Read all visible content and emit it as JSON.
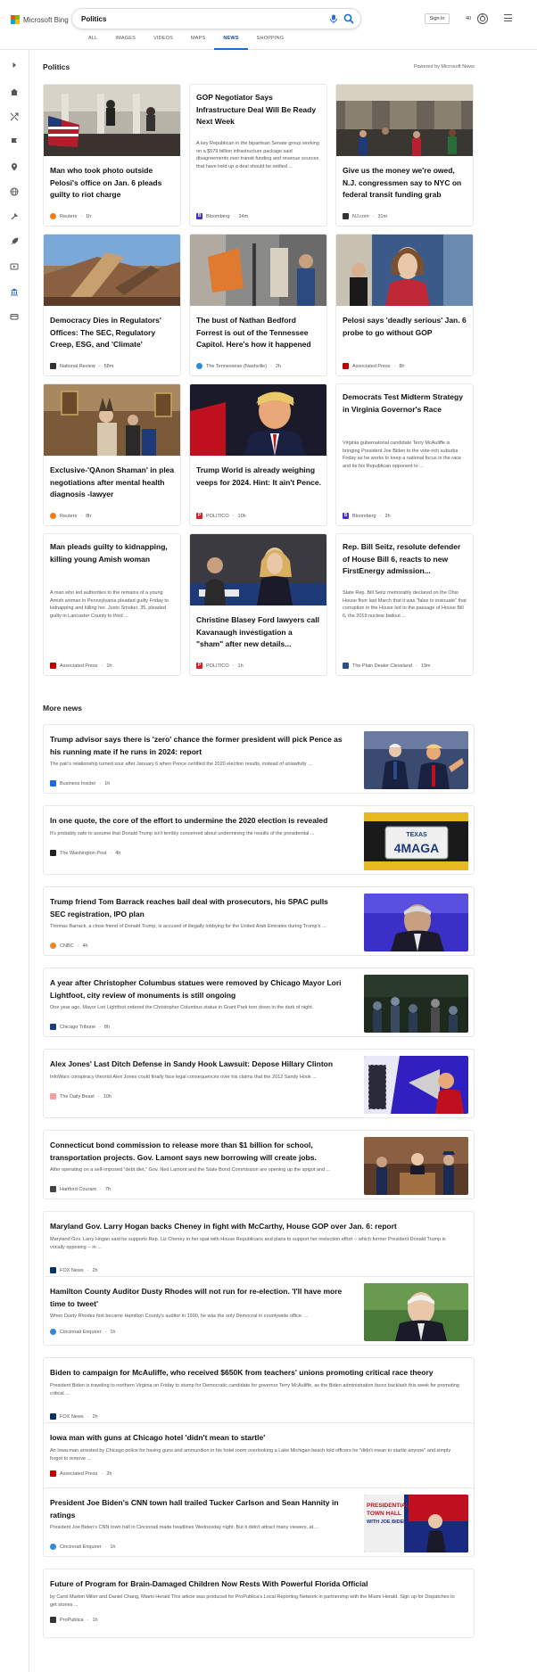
{
  "header": {
    "brand": "Microsoft Bing",
    "query": "Politics",
    "signin_label": "Sign in",
    "points": "40"
  },
  "tabs": [
    {
      "label": "ALL"
    },
    {
      "label": "IMAGES"
    },
    {
      "label": "VIDEOS"
    },
    {
      "label": "MAPS"
    },
    {
      "label": "NEWS",
      "active": true
    },
    {
      "label": "SHOPPING"
    }
  ],
  "section": {
    "title": "Politics",
    "powered": "Powered by Microsoft News"
  },
  "cards": [
    {
      "title": "Man who took photo outside Pelosi's office on Jan. 6 pleads guilty to riot charge",
      "source": "Reuters",
      "age": "1h",
      "icon": "reuters-icon",
      "color": "#f07a1a"
    },
    {
      "title": "GOP Negotiator Says Infrastructure Deal Will Be Ready Next Week",
      "snippet": "A key Republican in the bipartisan Senate group working on a $579 billion infrastructure package said disagreements over transit funding and revenue sources that have held up a deal should be settled ...",
      "source": "Bloomberg",
      "age": "34m",
      "icon": "bloomberg-icon",
      "color": "#472bd6"
    },
    {
      "title": "Give us the money we're owed, N.J. congressmen say to NYC on federal transit funding grab",
      "source": "NJ.com",
      "age": "31m",
      "icon": "njcom-icon",
      "color": "#333333"
    },
    {
      "title": "Democracy Dies in Regulators' Offices: The SEC, Regulatory Creep, ESG, and 'Climate'",
      "source": "National Review",
      "age": "58m",
      "icon": "national-review-icon",
      "color": "#333333"
    },
    {
      "title": "The bust of Nathan Bedford Forrest is out of the Tennessee Capitol. Here's how it happened",
      "source": "The Tennessean (Nashville)",
      "age": "2h",
      "icon": "tennessean-icon",
      "color": "#2f8ad8"
    },
    {
      "title": "Pelosi says 'deadly serious' Jan. 6 probe to go without GOP",
      "source": "Associated Press",
      "age": "8h",
      "icon": "ap-icon",
      "color": "#c00000"
    },
    {
      "title": "Exclusive-'QAnon Shaman' in plea negotiations after mental health diagnosis -lawyer",
      "source": "Reuters",
      "age": "8h",
      "icon": "reuters-icon",
      "color": "#f07a1a"
    },
    {
      "title": "Trump World is already weighing veeps for 2024. Hint: It ain't Pence.",
      "source": "POLITICO",
      "age": "10h",
      "icon": "politico-icon",
      "color": "#d8202a"
    },
    {
      "title": "Democrats Test Midterm Strategy in Virginia Governor's Race",
      "snippet": "Virginia gubernatorial candidate Terry McAuliffe is bringing President Joe Biden to the vote-rich suburbs Friday as he works to keep a national focus in the race and tie his Republican opponent to ...",
      "source": "Bloomberg",
      "age": "2h",
      "icon": "bloomberg-icon",
      "color": "#472bd6"
    },
    {
      "title": "Man pleads guilty to kidnapping, killing young Amish woman",
      "snippet": "A man who led authorities to the remains of a young Amish woman in Pennsylvania pleaded guilty Friday to kidnapping and killing her. Justo Smoker, 35, pleaded guilty in Lancaster County to third ...",
      "source": "Associated Press",
      "age": "1h",
      "icon": "ap-icon",
      "color": "#c00000"
    },
    {
      "title": "Christine Blasey Ford lawyers call Kavanaugh investigation a \"sham\" after new details...",
      "source": "POLITICO",
      "age": "1h",
      "icon": "politico-icon",
      "color": "#d8202a"
    },
    {
      "title": "Rep. Bill Seitz, resolute defender of House Bill 6, reacts to new FirstEnergy admission...",
      "snippet": "State Rep. Bill Seitz memorably declared on the Ohio House floor last March that it was \"false to insinuate\" that corruption in the House led to the passage of House Bill 6, the 2019 nuclear bailout ...",
      "source": "The Plain Dealer Cleveland",
      "age": "19m",
      "icon": "plain-dealer-icon",
      "color": "#2b4e8a"
    }
  ],
  "more_title": "More news",
  "more": [
    {
      "title": "Trump advisor says there is 'zero' chance the former president will pick Pence as his running mate if he runs in 2024: report",
      "snippet": "The pair's relationship turned sour after January 6 when Pence certified the 2020 election results, instead of unlawfully ...",
      "source": "Business Insider",
      "age": "1h",
      "icon": "business-insider-icon",
      "color": "#1e6be0"
    },
    {
      "title": "In one quote, the core of the effort to undermine the 2020 election is revealed",
      "snippet": "It's probably safe to assume that Donald Trump isn't terribly concerned about undermining the results of the presidential ...",
      "source": "The Washington Post",
      "age": "4h",
      "icon": "washington-post-icon",
      "color": "#222222"
    },
    {
      "title": "Trump friend Tom Barrack reaches bail deal with prosecutors, his SPAC pulls SEC registration, IPO plan",
      "snippet": "Thomas Barrack, a close friend of Donald Trump, is accused of illegally lobbying for the United Arab Emirates during Trump's ...",
      "source": "CNBC",
      "age": "4h",
      "icon": "cnbc-icon",
      "color": "#e8862a"
    },
    {
      "title": "A year after Christopher Columbus statues were removed by Chicago Mayor Lori Lightfoot, city review of monuments is still ongoing",
      "snippet": "One year ago, Mayor Lori Lightfoot ordered the Christopher Columbus statue in Grant Park torn down in the dark of night.",
      "source": "Chicago Tribune",
      "age": "8h",
      "icon": "chicago-tribune-icon",
      "color": "#1a3e78"
    },
    {
      "title": "Alex Jones' Last Ditch Defense in Sandy Hook Lawsuit: Depose Hillary Clinton",
      "snippet": "InfoWars conspiracy theorist Alex Jones could finally face legal consequences over his claims that the 2012 Sandy Hook ...",
      "source": "The Daily Beast",
      "age": "10h",
      "icon": "daily-beast-icon",
      "color": "#f3a0a0"
    },
    {
      "title": "Connecticut bond commission to release more than $1 billion for school, transportation projects. Gov. Lamont says new borrowing will create jobs.",
      "snippet": "After operating on a self-imposed \"debt diet,\" Gov. Ned Lamont and the State Bond Commission are opening up the spigot and ...",
      "source": "Hartford Courant",
      "age": "7h",
      "icon": "hartford-courant-icon",
      "color": "#444444"
    },
    {
      "title": "Maryland Gov. Larry Hogan backs Cheney in fight with McCarthy, House GOP over Jan. 6: report",
      "snippet": "Maryland Gov. Larry Hogan said he supports Rep. Liz Cheney in her spat with House Republicans and plans to support her reelection effort -- which former President Donald Trump is vocally opposing -- in ...",
      "source": "FOX News",
      "age": "2h",
      "icon": "fox-news-icon",
      "color": "#003366"
    },
    {
      "title": "Hamilton County Auditor Dusty Rhodes will not run for re-election. 'I'll have more time to tweet'",
      "snippet": "When Dusty Rhodes first became Hamilton County's auditor in 1990, he was the only Democrat in countywide office. ...",
      "source": "Cincinnati Enquirer",
      "age": "1h",
      "icon": "cincinnati-enquirer-icon",
      "color": "#2f8ad8"
    },
    {
      "title": "Biden to campaign for McAuliffe, who received $650K from teachers' unions promoting critical race theory",
      "snippet": "President Biden is traveling to northern Virginia on Friday to stump for Democratic candidate for governor Terry McAuliffe, as the Biden administration faces backlash this week for promoting critical ...",
      "source": "FOX News",
      "age": "2h",
      "icon": "fox-news-icon",
      "color": "#003366"
    },
    {
      "title": "Iowa man with guns at Chicago hotel 'didn't mean to startle'",
      "snippet": "An Iowa man arrested by Chicago police for having guns and ammunition in his hotel room overlooking a Lake Michigan beach told officers he \"didn't mean to startle anyone\" and simply forgot to remove ...",
      "source": "Associated Press",
      "age": "2h",
      "icon": "ap-icon",
      "color": "#c00000"
    },
    {
      "title": "President Joe Biden's CNN town hall trailed Tucker Carlson and Sean Hannity in ratings",
      "snippet": "President Joe Biden's CNN town hall in Cincinnati made headlines Wednesday night. But it didn't attract many viewers, at ...",
      "source": "Cincinnati Enquirer",
      "age": "1h",
      "icon": "cincinnati-enquirer-icon",
      "color": "#2f8ad8",
      "thumb_text": [
        "PRESIDENTIAL",
        "TOWN HALL",
        "WITH JOE BIDEN"
      ]
    },
    {
      "title": "Future of Program for Brain-Damaged Children Now Rests With Powerful Florida Official",
      "snippet": "by Carol Marbin Miller and Daniel Chang, Miami Herald This article was produced for ProPublica's Local Reporting Network in partnership with the Miami Herald. Sign up for Dispatches to get stories ...",
      "source": "ProPublica",
      "age": "1h",
      "icon": "propublica-icon",
      "color": "#333333"
    }
  ],
  "plate": {
    "state": "TEXAS",
    "text": "4MAGA"
  }
}
